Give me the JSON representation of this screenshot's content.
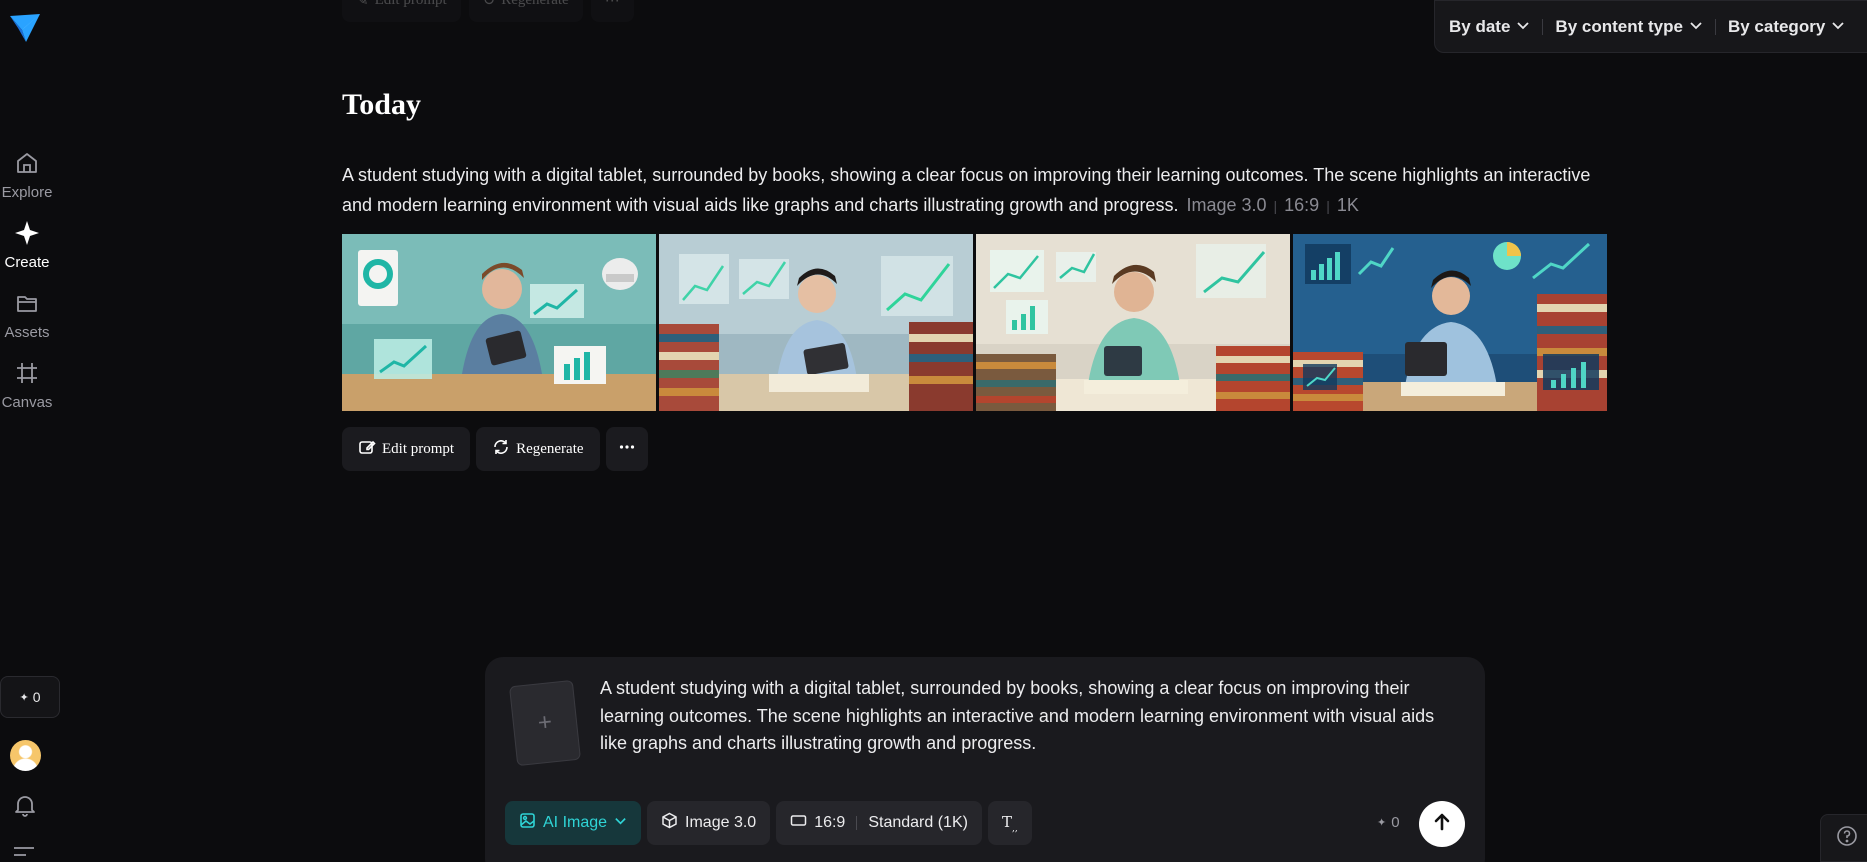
{
  "sidebar": {
    "logo_icon": "paper-plane-logo",
    "items": [
      {
        "label": "Explore",
        "icon": "home-icon",
        "active": false
      },
      {
        "label": "Create",
        "icon": "sparkle-icon",
        "active": true
      },
      {
        "label": "Assets",
        "icon": "folder-icon",
        "active": false
      },
      {
        "label": "Canvas",
        "icon": "canvas-icon",
        "active": false
      }
    ],
    "credits": "0",
    "credits_icon": "sparkle-icon"
  },
  "filters": {
    "by_date": "By date",
    "by_content_type": "By content type",
    "by_category": "By category"
  },
  "ghost_actions": {
    "edit_prompt": "Edit prompt",
    "regenerate": "Regenerate"
  },
  "section": {
    "title": "Today"
  },
  "generation": {
    "prompt": "A student studying with a digital tablet, surrounded by books, showing a clear focus on improving their learning outcomes. The scene highlights an interactive and modern learning environment with visual aids like graphs and charts illustrating growth and progress.",
    "model": "Image 3.0",
    "ratio": "16:9",
    "resolution": "1K",
    "images": [
      {
        "alt": "student with tablet, desk lamp, chart cards"
      },
      {
        "alt": "student at tablet with stacks of books and growth graphs"
      },
      {
        "alt": "student in teal sweater with tablet and charts"
      },
      {
        "alt": "student in blue room with tablet and bar charts"
      }
    ],
    "actions": {
      "edit_prompt": "Edit prompt",
      "regenerate": "Regenerate",
      "more": "more"
    }
  },
  "composer": {
    "add_symbol": "+",
    "text": "A student studying with a digital tablet, surrounded by books, showing a clear focus on improving their learning outcomes. The scene highlights an interactive and modern learning environment with visual aids like graphs and charts illustrating growth and progress.",
    "mode": "AI Image",
    "model": "Image 3.0",
    "ratio": "16:9",
    "quality": "Standard (1K)",
    "cost": "0",
    "accent": "#2fd4d6"
  },
  "colors": {
    "background": "#0c0c0e",
    "panel": "#1a1a1e",
    "accent": "#2fd4d6",
    "logo": "#2aa3ff"
  }
}
